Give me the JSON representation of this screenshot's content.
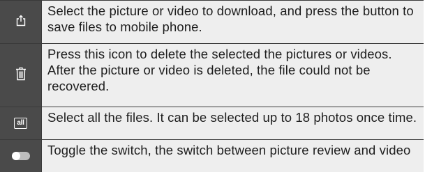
{
  "rows": [
    {
      "icon": "download-icon",
      "text": "Select the picture or video to download, and press the button to save files to mobile phone."
    },
    {
      "icon": "trash-icon",
      "text": "Press this icon to delete the selected the pictures or videos. After the picture or video is deleted, the file could not be recovered."
    },
    {
      "icon": "select-all-icon",
      "icon_label": "all",
      "text": "Select all the files. It can be selected up to 18 photos once time."
    },
    {
      "icon": "toggle-switch-icon",
      "text": "Toggle the switch, the switch between picture review and video"
    }
  ],
  "colors": {
    "icon_cell_bg": "#4a4a4a",
    "text_cell_bg": "#eeeeee",
    "border": "#3a3a3a",
    "text": "#1e1e1e"
  }
}
